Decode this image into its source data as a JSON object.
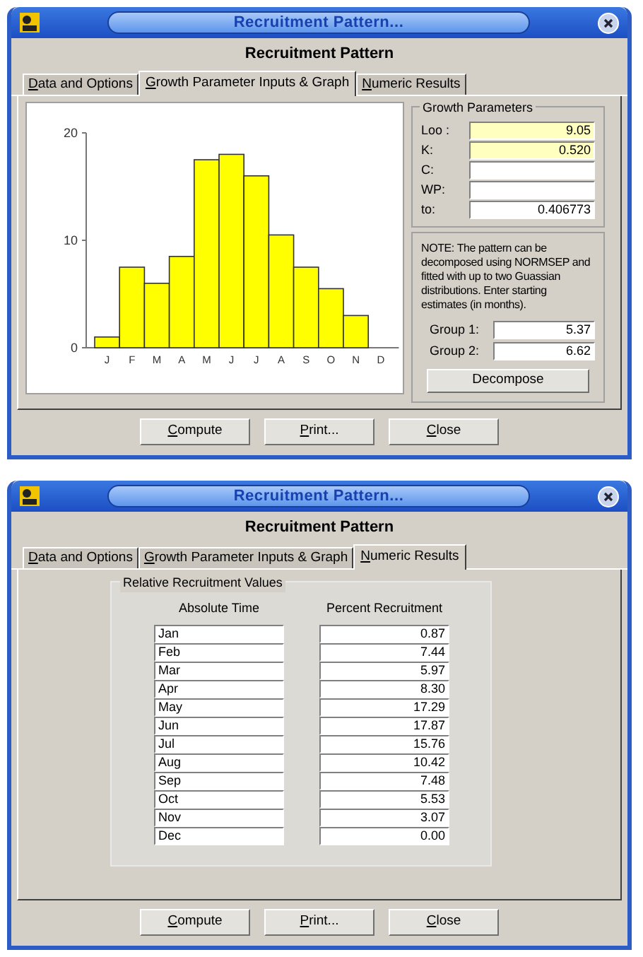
{
  "windows": [
    {
      "kind": "graph",
      "title": "Recruitment Pattern...",
      "heading": "Recruitment Pattern",
      "tabs": [
        {
          "key": "D",
          "rest": "ata and Options",
          "selected": false
        },
        {
          "key": "G",
          "rest": "rowth Parameter Inputs & Graph",
          "selected": true
        },
        {
          "key": "N",
          "rest": "umeric Results",
          "selected": false
        }
      ],
      "chart_data": {
        "type": "bar",
        "categories": [
          "J",
          "F",
          "M",
          "A",
          "M",
          "J",
          "J",
          "A",
          "S",
          "O",
          "N",
          "D"
        ],
        "values": [
          1,
          7.5,
          6,
          8.5,
          17.5,
          18,
          16,
          10.5,
          7.5,
          5.5,
          3,
          0
        ],
        "ylim": [
          0,
          20
        ],
        "yticks": [
          0,
          10,
          20
        ]
      },
      "growth_parameters": {
        "title": "Growth Parameters",
        "fields": [
          {
            "label": "Loo :",
            "value": "9.05",
            "highlighted": true
          },
          {
            "label": "K:",
            "value": "0.520",
            "highlighted": true
          },
          {
            "label": "C:",
            "highlighted": false
          },
          {
            "label": "WP:",
            "highlighted": false
          },
          {
            "label": "to:",
            "value": "0.406773",
            "highlighted": false
          }
        ]
      },
      "note": "NOTE: The pattern can be decomposed using NORMSEP and fitted with up to two Guassian distributions.  Enter starting estimates (in months).",
      "groups": [
        {
          "label": "Group 1:",
          "value": "5.37"
        },
        {
          "label": "Group 2:",
          "value": "6.62"
        }
      ],
      "decompose_button": "Decompose",
      "buttons": [
        {
          "key": "C",
          "rest": "ompute"
        },
        {
          "key": "P",
          "rest": "rint..."
        },
        {
          "key": "C",
          "rest": "lose"
        }
      ]
    },
    {
      "kind": "results",
      "title": "Recruitment Pattern...",
      "heading": "Recruitment Pattern",
      "tabs": [
        {
          "key": "D",
          "rest": "ata and Options",
          "selected": false
        },
        {
          "key": "G",
          "rest": "rowth Parameter Inputs & Graph",
          "selected": false
        },
        {
          "key": "N",
          "rest": "umeric Results",
          "selected": true
        }
      ],
      "results": {
        "title": "Relative Recruitment Values",
        "columns": [
          "Absolute Time",
          "Percent Recruitment"
        ],
        "rows": [
          [
            "Jan",
            "0.87"
          ],
          [
            "Feb",
            "7.44"
          ],
          [
            "Mar",
            "5.97"
          ],
          [
            "Apr",
            "8.30"
          ],
          [
            "May",
            "17.29"
          ],
          [
            "Jun",
            "17.87"
          ],
          [
            "Jul",
            "15.76"
          ],
          [
            "Aug",
            "10.42"
          ],
          [
            "Sep",
            "7.48"
          ],
          [
            "Oct",
            "5.53"
          ],
          [
            "Nov",
            "3.07"
          ],
          [
            "Dec",
            "0.00"
          ]
        ]
      },
      "buttons": [
        {
          "key": "C",
          "rest": "ompute"
        },
        {
          "key": "P",
          "rest": "rint..."
        },
        {
          "key": "C",
          "rest": "lose"
        }
      ]
    }
  ]
}
